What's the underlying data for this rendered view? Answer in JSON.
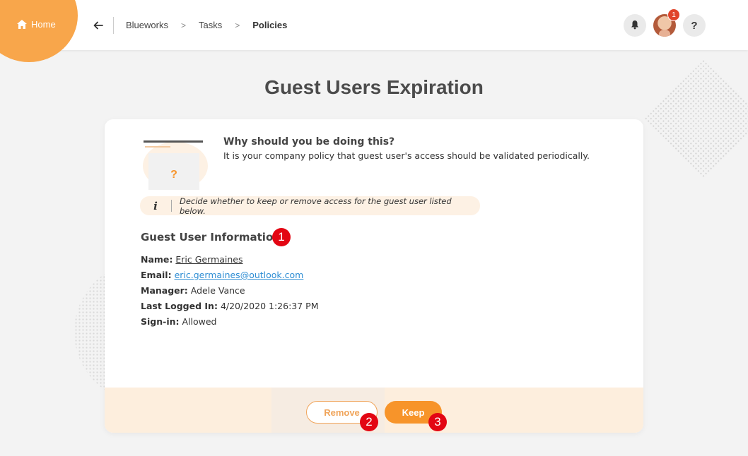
{
  "header": {
    "home_label": "Home",
    "breadcrumbs": [
      "Blueworks",
      "Tasks",
      "Policies"
    ],
    "crumb_separator": ">",
    "notification_count": "1",
    "help_label": "?"
  },
  "page": {
    "title": "Guest Users Expiration"
  },
  "why": {
    "title": "Why should you be doing this?",
    "text": "It is your company policy that guest user's access should be validated periodically.",
    "illustration_glyph": "?"
  },
  "info": {
    "icon": "i",
    "text": "Decide whether to keep or remove access for the guest user listed below."
  },
  "guest": {
    "section_title": "Guest User Information",
    "name_label": "Name:",
    "name_value": "Eric Germaines",
    "email_label": "Email:",
    "email_value": "eric.germaines@outlook.com",
    "manager_label": "Manager:",
    "manager_value": "Adele Vance",
    "last_logged_label": "Last Logged In:",
    "last_logged_value": "4/20/2020 1:26:37 PM",
    "signin_label": "Sign-in:",
    "signin_value": "Allowed"
  },
  "actions": {
    "remove_label": "Remove",
    "keep_label": "Keep"
  },
  "callouts": [
    "1",
    "2",
    "3"
  ],
  "colors": {
    "accent": "#f7942a",
    "home_circle": "#f8a64b",
    "callout": "#e30613",
    "link": "#2f8ed4",
    "footer_bg": "#fdeedd"
  }
}
